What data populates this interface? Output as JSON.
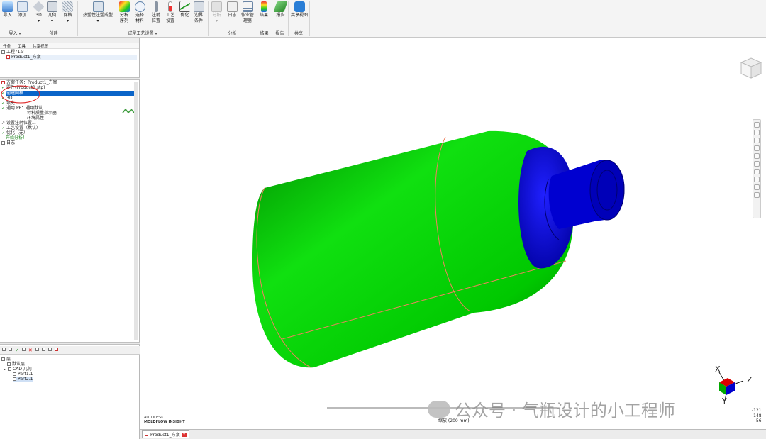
{
  "ribbon": {
    "buttons": [
      {
        "id": "import",
        "label": "导入"
      },
      {
        "id": "add",
        "label": "添加"
      },
      {
        "id": "3d",
        "label": "3D"
      },
      {
        "id": "geometry",
        "label": "几何"
      },
      {
        "id": "mesh",
        "label": "网格"
      },
      {
        "id": "thermoplastic",
        "label": "热塑性注塑成型"
      },
      {
        "id": "analysis-seq",
        "label": "分析序列"
      },
      {
        "id": "select-material",
        "label": "选择材料"
      },
      {
        "id": "injection-loc",
        "label": "注射位置"
      },
      {
        "id": "process-settings",
        "label": "工艺设置"
      },
      {
        "id": "optimize",
        "label": "优化"
      },
      {
        "id": "boundary",
        "label": "边界条件"
      },
      {
        "id": "analyze",
        "label": "分析"
      },
      {
        "id": "log",
        "label": "日志"
      },
      {
        "id": "job-manager",
        "label": "作业管理器"
      },
      {
        "id": "results",
        "label": "结果"
      },
      {
        "id": "report",
        "label": "报告"
      },
      {
        "id": "share-view",
        "label": "共享视图"
      }
    ],
    "groups": [
      "导入",
      "创建",
      "成型工艺设置",
      "分析",
      "结果",
      "报告",
      "共享"
    ]
  },
  "project_panel": {
    "tabs": [
      "任务",
      "工具",
      "共享视图"
    ],
    "project": "工程 '1a'",
    "study": "Product1_方案"
  },
  "task_panel": {
    "items": [
      "方案任务：Product1_方案",
      "零件(Product1.stp)",
      "创建网格...",
      "3D",
      "填充",
      "通用 PP：通用默认",
      "材料质量指示器",
      "环境属性",
      "设置注射位置...",
      "工艺设置（默认）",
      "优化（无）",
      "开始分析！",
      "日志"
    ]
  },
  "layers": {
    "items": [
      "层",
      "默认层",
      "CAD 几何",
      "Part1.1",
      "Part2.1"
    ]
  },
  "viewport": {
    "watermark": "公众号 · 气瓶设计的小工程师",
    "scale_label": "缩放 (200 mm)",
    "brand_line1": "AUTODESK",
    "brand_line2": "MOLDFLOW INSIGHT",
    "axes": {
      "x": "X",
      "y": "Y",
      "z": "Z"
    },
    "coords": [
      "-121",
      "-148",
      "-56"
    ],
    "colors": {
      "body": "#00d800",
      "neck": "#0000e0",
      "edge": "#f08060"
    }
  },
  "doc_tab": "Product1_方案"
}
